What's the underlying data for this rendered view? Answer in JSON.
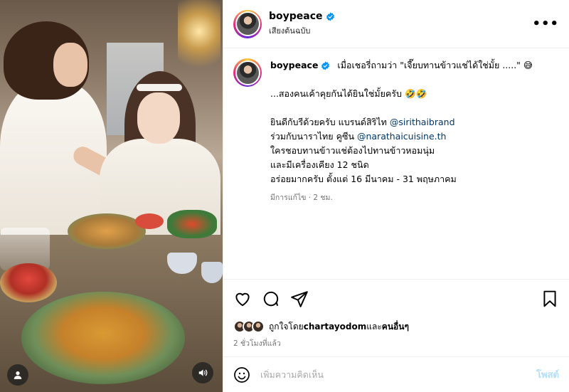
{
  "post": {
    "username": "boypeace",
    "audio_label": "เสียงต้นฉบับ",
    "more_label": "•••"
  },
  "caption": {
    "username": "boypeace",
    "line1": "เมื่อเชอรี่ถามว่า \"เจี๊ยบทานข้าวแช่ได้ใช่มั้ย .....\"",
    "line1_emoji": "😅",
    "line2": "...สองคนเค้าคุยกันได้ยินใช่มั้ยครับ",
    "line2_emoji": "🤣🤣",
    "line3_text": "ยินดีกับรีด้วยครับ แบรนด์สิริไท ",
    "line3_mention": "@sirithaibrand",
    "line4_text": "ร่วมกับนาราไทย คูซีน ",
    "line4_mention": "@narathaicuisine.th",
    "line5": "ใครชอบทานข้าวแช่ต้องไปทานข้าวหอมนุ่ม",
    "line6": "และมีเครื่องเคียง 12 ชนิด",
    "line7": "อร่อยมากครับ ตั้งแต่ 16 มีนาคม - 31 พฤษภาคม",
    "edited_meta": "มีการแก้ไข · 2 ชม."
  },
  "likes": {
    "prefix": "ถูกใจโดย ",
    "user": "chartayodom",
    "middle": " และ",
    "others": "คนอื่นๆ"
  },
  "timestamp": "2 ชั่วโมงที่แล้ว",
  "comment": {
    "placeholder": "เพิ่มความคิดเห็น",
    "post_label": "โพสต์"
  },
  "colors": {
    "verified": "#0095f6",
    "mention": "#00376b",
    "post_button_disabled": "#b2dffc"
  },
  "icons": {
    "header_more": "more-icon",
    "actions": [
      "heart-icon",
      "comment-icon",
      "share-icon",
      "bookmark-icon"
    ],
    "media": [
      "user-tag-icon",
      "sound-icon"
    ],
    "comment": "emoji-icon"
  }
}
